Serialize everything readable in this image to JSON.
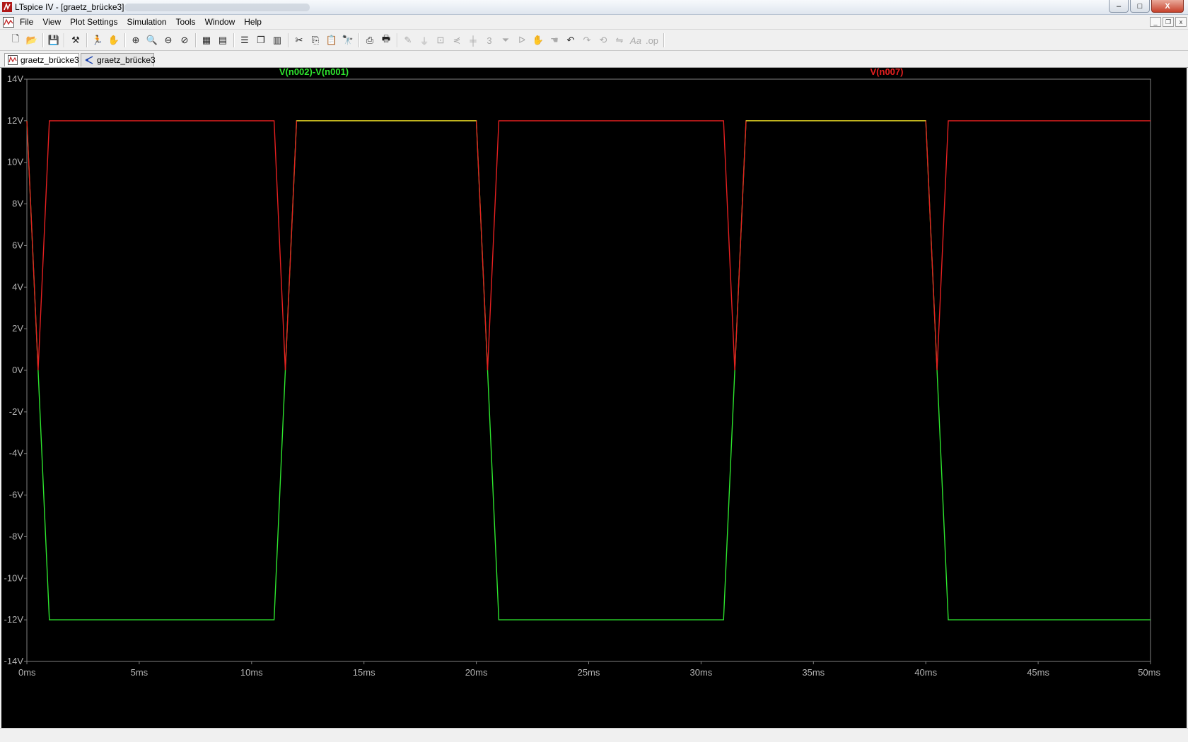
{
  "window": {
    "title": "LTspice IV - [graetz_brücke3]",
    "minimize": "–",
    "maximize": "□",
    "close": "X"
  },
  "menu": [
    "File",
    "View",
    "Plot Settings",
    "Simulation",
    "Tools",
    "Window",
    "Help"
  ],
  "mdi": {
    "minimize": "_",
    "restore": "❐",
    "close": "x"
  },
  "toolbar_icons": [
    "new-schematic-icon",
    "open-icon",
    "save-icon",
    "control-panel-icon",
    "run-icon",
    "halt-icon",
    "zoom-in-icon",
    "zoom-full-icon",
    "zoom-out-icon",
    "zoom-cancel-icon",
    "autorange-icon",
    "manual-limits-icon",
    "tile-horizontal-icon",
    "cascade-icon",
    "tile-vertical-icon",
    "cut-icon",
    "copy-icon",
    "paste-icon",
    "find-icon",
    "print-setup-icon",
    "print-icon",
    "draw-wire-icon",
    "ground-icon",
    "label-net-icon",
    "resistor-icon",
    "capacitor-icon",
    "inductor-icon",
    "diode-icon",
    "component-icon",
    "move-icon",
    "drag-icon",
    "undo-icon",
    "redo-icon",
    "rotate-icon",
    "mirror-icon",
    "text-icon",
    "spice-directive-icon"
  ],
  "tabs": [
    {
      "label": "graetz_brücke3",
      "type": "waveform",
      "active": true
    },
    {
      "label": "graetz_brücke3",
      "type": "schematic",
      "active": false
    }
  ],
  "colors": {
    "background": "#000000",
    "axis": "#808080",
    "tick_label": "#b4b4b4",
    "series_green": "#2ee62e",
    "series_red": "#e62020",
    "overlap": "#d8d820"
  },
  "chart_data": {
    "type": "line",
    "xlabel": "",
    "ylabel": "",
    "xlim": [
      0,
      50
    ],
    "ylim": [
      -14,
      14
    ],
    "x_unit": "ms",
    "y_unit": "V",
    "x_ticks": [
      "0ms",
      "5ms",
      "10ms",
      "15ms",
      "20ms",
      "25ms",
      "30ms",
      "35ms",
      "40ms",
      "45ms",
      "50ms"
    ],
    "y_ticks": [
      "14V",
      "12V",
      "10V",
      "8V",
      "6V",
      "4V",
      "2V",
      "0V",
      "-2V",
      "-4V",
      "-6V",
      "-8V",
      "-10V",
      "-12V",
      "-14V"
    ],
    "x_tick_values": [
      0,
      5,
      10,
      15,
      20,
      25,
      30,
      35,
      40,
      45,
      50
    ],
    "y_tick_values": [
      14,
      12,
      10,
      8,
      6,
      4,
      2,
      0,
      -2,
      -4,
      -6,
      -8,
      -10,
      -12,
      -14
    ],
    "grid": false,
    "series": [
      {
        "name": "V(n002)-V(n001)",
        "color": "#2ee62e",
        "x": [
          0,
          0.5,
          1.0,
          11.0,
          11.5,
          12.0,
          20.0,
          20.5,
          21.0,
          31.0,
          31.5,
          32.0,
          40.0,
          40.5,
          41.0,
          50.0
        ],
        "y": [
          12,
          0,
          -12,
          -12,
          0,
          12,
          12,
          0,
          -12,
          -12,
          0,
          12,
          12,
          0,
          -12,
          -12
        ]
      },
      {
        "name": "V(n007)",
        "color": "#e62020",
        "x": [
          0,
          0.5,
          1.0,
          11.0,
          11.5,
          12.0,
          20.0,
          20.5,
          21.0,
          31.0,
          31.5,
          32.0,
          40.0,
          40.5,
          41.0,
          50.0
        ],
        "y": [
          12,
          0,
          12,
          12,
          0,
          12,
          12,
          0,
          12,
          12,
          0,
          12,
          12,
          0,
          12,
          12
        ]
      }
    ]
  }
}
